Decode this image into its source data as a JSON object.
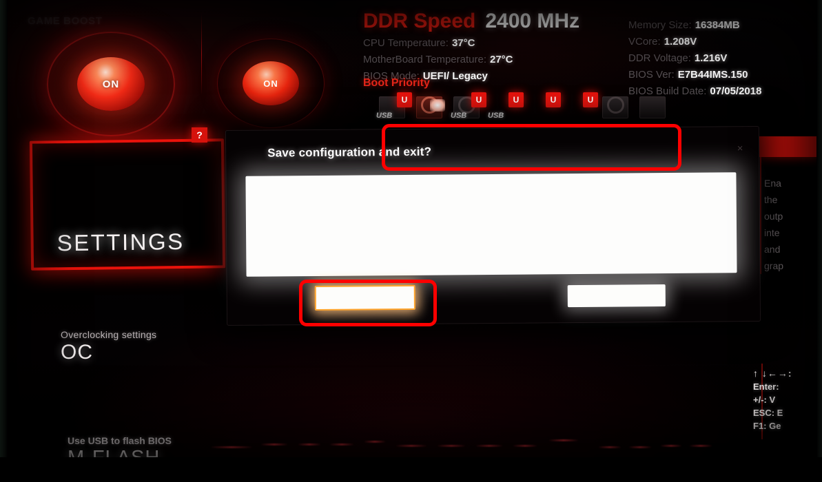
{
  "screen": {
    "kind": "bios-setup",
    "vendor_ui": "MSI Click BIOS"
  },
  "top_bar": {
    "game_boost_label": "GAME BOOST",
    "game_boost_button": "ON",
    "xmp_button": "ON",
    "ddr_speed_label": "DDR Speed",
    "ddr_speed_value": "2400 MHz",
    "stats_left": [
      {
        "key": "CPU Temperature:",
        "value": "37°C"
      },
      {
        "key": "MotherBoard Temperature:",
        "value": "27°C"
      },
      {
        "key": "BIOS Mode:",
        "value": "UEFI/ Legacy"
      }
    ],
    "stats_right": [
      {
        "key": "Memory Size:",
        "value": "16384MB"
      },
      {
        "key": "VCore:",
        "value": "1.208V"
      },
      {
        "key": "DDR Voltage:",
        "value": "1.216V"
      },
      {
        "key": "BIOS Ver:",
        "value": "E7B44IMS.150"
      },
      {
        "key": "BIOS Build Date:",
        "value": "07/05/2018"
      }
    ],
    "boot_priority_label": "Boot Priority",
    "boot_devices": [
      {
        "name": "boot-device-floppy",
        "badge": "U",
        "sublabel": "USB"
      },
      {
        "name": "boot-device-hdd",
        "badge": "",
        "sublabel": ""
      },
      {
        "name": "boot-device-optical",
        "badge": "U",
        "sublabel": "USB"
      },
      {
        "name": "boot-device-usb",
        "badge": "U",
        "sublabel": "USB"
      },
      {
        "name": "boot-device-lan",
        "badge": "U",
        "sublabel": ""
      },
      {
        "name": "boot-device-network",
        "badge": "U",
        "sublabel": ""
      },
      {
        "name": "boot-device-disc",
        "badge": "",
        "sublabel": ""
      },
      {
        "name": "boot-device-usb-2",
        "badge": "",
        "sublabel": "USB"
      }
    ]
  },
  "left_panel": {
    "settings_tile_label": "SETTINGS",
    "help_badge": "?",
    "oc_sublabel": "Overclocking settings",
    "oc_label": "OC",
    "mflash_sublabel": "Use USB to flash BIOS",
    "mflash_label": "M-FLASH"
  },
  "right_panel": {
    "help_lines": [
      "Ena",
      "the",
      "outp",
      "inte",
      "and",
      "grap"
    ],
    "key_hints": [
      "↑ ↓←→:",
      "Enter:",
      "+/-: V",
      "ESC: E",
      "F1: Ge"
    ]
  },
  "dialog": {
    "title": "Save configuration and exit?",
    "close_label": "×",
    "message": "",
    "ok_label": "",
    "cancel_label": ""
  },
  "annotations": {
    "color": "#ff0000",
    "boxes": [
      {
        "name": "annotation-dialog-title",
        "target": "dialog title"
      },
      {
        "name": "annotation-ok-button",
        "target": "dialog confirm button"
      }
    ]
  }
}
